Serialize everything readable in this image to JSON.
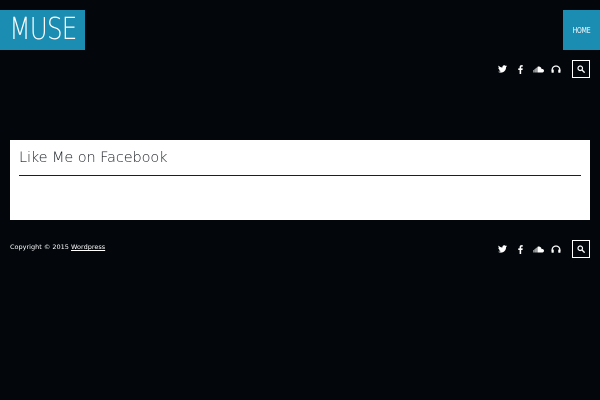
{
  "header": {
    "logo_text": "MUSE",
    "nav_home": "HOME"
  },
  "social": {
    "icons": [
      "twitter-icon",
      "facebook-icon",
      "soundcloud-icon",
      "headphones-icon",
      "search-icon"
    ]
  },
  "widget": {
    "title": "Like Me on Facebook"
  },
  "footer": {
    "copyright_prefix": "Copyright © 2015",
    "link_label": "Wordpress"
  },
  "colors": {
    "background": "#03070c",
    "accent": "#1b8db3",
    "widget_bg": "#ffffff",
    "widget_text": "#1c2026"
  }
}
